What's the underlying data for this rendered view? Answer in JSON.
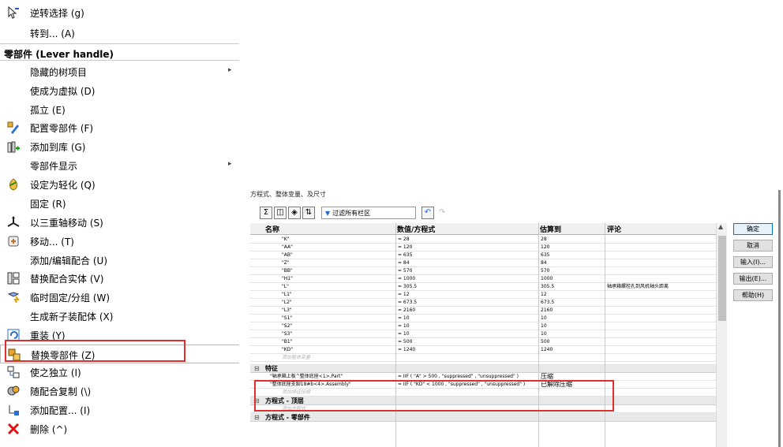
{
  "menu": {
    "items_top": [
      {
        "label": "逆转选择 (g)",
        "icon": "reverse-select-icon"
      },
      {
        "label": "转到... (A)",
        "icon": ""
      }
    ],
    "header": "零部件 (Lever handle)",
    "items": [
      {
        "label": "隐藏的树项目",
        "icon": "",
        "submenu": true
      },
      {
        "label": "使成为虚拟 (D)",
        "icon": ""
      },
      {
        "label": "孤立 (E)",
        "icon": ""
      },
      {
        "label": "配置零部件 (F)",
        "icon": "configure-component-icon"
      },
      {
        "label": "添加到库 (G)",
        "icon": "add-to-library-icon"
      },
      {
        "label": "零部件显示",
        "icon": "",
        "submenu": true
      },
      {
        "label": "设定为轻化 (Q)",
        "icon": "lightweight-icon"
      },
      {
        "label": "固定 (R)",
        "icon": ""
      },
      {
        "label": "以三重轴移动 (S)",
        "icon": "triad-move-icon"
      },
      {
        "label": "移动... (T)",
        "icon": "move-component-icon"
      },
      {
        "label": "添加/编辑配合 (U)",
        "icon": ""
      },
      {
        "label": "替换配合实体 (V)",
        "icon": "replace-mate-entities-icon"
      },
      {
        "label": "临时固定/分组 (W)",
        "icon": "temp-fix-group-icon"
      },
      {
        "label": "生成新子装配体 (X)",
        "icon": ""
      },
      {
        "label": "重装 (Y)",
        "icon": "reload-icon"
      },
      {
        "label": "替换零部件 (Z)",
        "icon": "replace-component-icon",
        "selected": true
      },
      {
        "label": "使之独立 (I)",
        "icon": "make-independent-icon"
      },
      {
        "label": "随配合复制 (\\)",
        "icon": "copy-with-mates-icon"
      },
      {
        "label": "添加配置... (I)",
        "icon": "add-configuration-icon"
      },
      {
        "label": "删除 (^)",
        "icon": "delete-icon"
      }
    ],
    "submenu_arrow": "▸"
  },
  "dialog": {
    "title": "方程式、整体变量、及尺寸",
    "filter_label": "过滤所有栏区",
    "columns": [
      "名称",
      "数值/方程式",
      "估算到",
      "评论"
    ],
    "global_vars": [
      {
        "name": "\"K\"",
        "expr": "= 28",
        "eval": "28",
        "comment": ""
      },
      {
        "name": "\"AA\"",
        "expr": "= 120",
        "eval": "120",
        "comment": ""
      },
      {
        "name": "\"AB\"",
        "expr": "= 635",
        "eval": "635",
        "comment": ""
      },
      {
        "name": "\"Z\"",
        "expr": "= 84",
        "eval": "84",
        "comment": ""
      },
      {
        "name": "\"BB\"",
        "expr": "= 570",
        "eval": "570",
        "comment": ""
      },
      {
        "name": "\"H1\"",
        "expr": "= 1000",
        "eval": "1000",
        "comment": ""
      },
      {
        "name": "\"L\"",
        "expr": "= 305.5",
        "eval": "305.5",
        "comment": "轴承箱螺栓孔到风机轴头距离"
      },
      {
        "name": "\"L1\"",
        "expr": "= 12",
        "eval": "12",
        "comment": ""
      },
      {
        "name": "\"L2\"",
        "expr": "= 673.5",
        "eval": "673.5",
        "comment": ""
      },
      {
        "name": "\"L3\"",
        "expr": "= 2160",
        "eval": "2160",
        "comment": ""
      },
      {
        "name": "\"S1\"",
        "expr": "= 10",
        "eval": "10",
        "comment": ""
      },
      {
        "name": "\"S2\"",
        "expr": "= 10",
        "eval": "10",
        "comment": ""
      },
      {
        "name": "\"S3\"",
        "expr": "= 10",
        "eval": "10",
        "comment": ""
      },
      {
        "name": "\"B1\"",
        "expr": "= 500",
        "eval": "500",
        "comment": ""
      },
      {
        "name": "\"KD\"",
        "expr": "= 1240",
        "eval": "1240",
        "comment": ""
      }
    ],
    "add_global_placeholder": "添加整体变量",
    "features_section": "特征",
    "features": [
      {
        "name": "\"轴承箱上板^整体底座<1>.Part\"",
        "expr": "= IIF ( \"A\" > 500 , \"suppressed\" , \"unsuppressed\" )",
        "eval": "压缩"
      },
      {
        "name": "\"整体底座支脚18#b<4>.Assembly\"",
        "expr": "= IIF ( \"KD\" < 1000 , \"suppressed\" , \"unsuppressed\" )",
        "eval": "已解除压缩"
      }
    ],
    "add_feature_placeholder": "添加特征压缩",
    "eq_top_section": "方程式 - 顶层",
    "add_eq_placeholder": "添加方程式",
    "eq_parts_section": "方程式 - 零部件",
    "toggle_glyph": "⊟",
    "buttons": [
      "确定",
      "取消",
      "输入(I)...",
      "输出(E)...",
      "帮助(H)"
    ]
  },
  "colors": {
    "highlight_box": "#e32c2c",
    "primary_button_border": "#0078d7"
  }
}
